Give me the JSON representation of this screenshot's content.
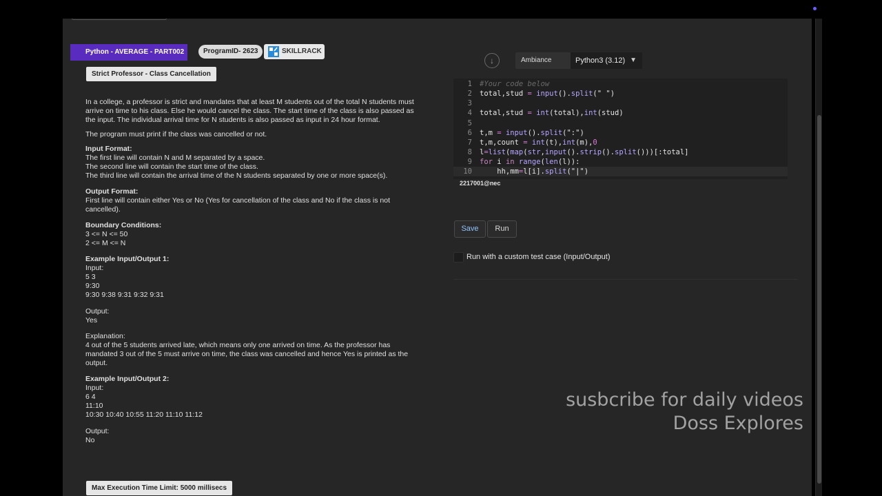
{
  "header": {
    "category": "Python - AVERAGE - PART002",
    "program_id": "ProgramID- 2623",
    "brand": "SKILLRACK",
    "title": "Strict Professor - Class Cancellation"
  },
  "problem": {
    "intro": "In a college, a professor is strict and mandates that at least M students out of the total N students must arrive on time to his class. Else he would cancel the class. The start time of the class is also passed as the input. The individual arrival time for N students is also passed as input in 24 hour format.",
    "task": "The program must print if the class was cancelled or not.",
    "input_format_h": "Input Format:",
    "input_format": [
      "The first line will contain N and M separated by a space.",
      "The second line will contain the start time of the class.",
      "The third line will contain the arrival time of the N students separated by one or more space(s)."
    ],
    "output_format_h": "Output Format:",
    "output_format": "First line will contain either Yes or No (Yes for cancellation of the class and No if the class is not cancelled).",
    "boundary_h": "Boundary Conditions:",
    "boundary": [
      "3 <= N <= 50",
      "2 <= M <= N"
    ],
    "ex1_h": "Example Input/Output 1:",
    "ex1_input_label": "Input:",
    "ex1_input": [
      "5 3",
      "9:30",
      "9:30 9:38 9:31 9:32 9:31"
    ],
    "ex1_output_label": "Output:",
    "ex1_output": "Yes",
    "ex1_expl_label": "Explanation:",
    "ex1_expl": "4 out of the 5 students arrived late, which means only one arrived on time. As the professor has mandated 3 out of the 5 must arrive on time, the class was cancelled and hence Yes is printed as the output.",
    "ex2_h": "Example Input/Output 2:",
    "ex2_input_label": "Input:",
    "ex2_input": [
      "6 4",
      "11:10",
      "10:30 10:40 10:55 11:20 11:10 11:12"
    ],
    "ex2_output_label": "Output:",
    "ex2_output": "No",
    "limit": "Max Execution Time Limit: 5000 millisecs"
  },
  "editor": {
    "ambiance": "Ambiance",
    "language": "Python3 (3.12)",
    "line_numbers": [
      "1",
      "2",
      "3",
      "4",
      "5",
      "6",
      "7",
      "8",
      "9",
      "10"
    ],
    "user": "2217001@nec"
  },
  "actions": {
    "save": "Save",
    "run": "Run",
    "custom_test": "Run with a custom test case (Input/Output)"
  },
  "watermark": {
    "line1": "susbcribe for daily videos",
    "line2": "Doss Explores"
  },
  "colors": {
    "category_badge": "#5a2bbf",
    "accent_link": "#8ec5ff",
    "scroll_dot": "#6a5cff"
  },
  "icons": [
    "download-icon",
    "chevron-down-icon",
    "skillrack-logo-icon"
  ]
}
